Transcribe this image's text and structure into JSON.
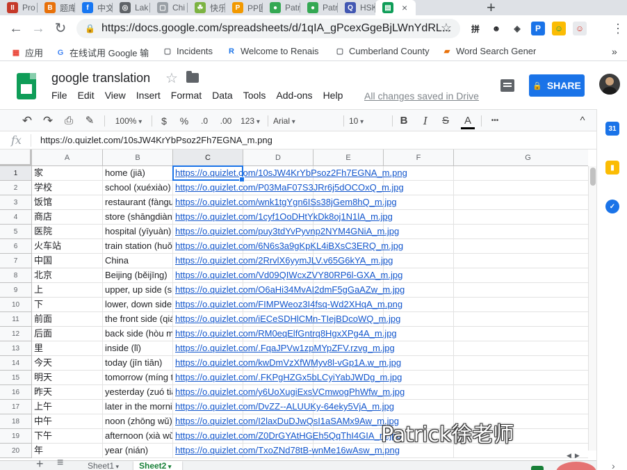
{
  "browser": {
    "tabs": [
      {
        "title": "Pro",
        "color": "#c53929",
        "glyph": "II"
      },
      {
        "title": "题库",
        "color": "#e8710a",
        "glyph": "B"
      },
      {
        "title": "中文",
        "color": "#1877f2",
        "glyph": "f"
      },
      {
        "title": "Lak",
        "color": "#5f6368",
        "glyph": "◎"
      },
      {
        "title": "Chi",
        "color": "#9aa0a6",
        "glyph": "▢"
      },
      {
        "title": "快乐",
        "color": "#7cb342",
        "glyph": "☘"
      },
      {
        "title": "PP匠",
        "color": "#f29900",
        "glyph": "P"
      },
      {
        "title": "Patr",
        "color": "#34a853",
        "glyph": "●"
      },
      {
        "title": "Patr",
        "color": "#34a853",
        "glyph": "●"
      },
      {
        "title": "HSK",
        "color": "#4257b2",
        "glyph": "Q"
      },
      {
        "title": "",
        "color": "#0f9d58",
        "glyph": "▤",
        "active": true
      }
    ],
    "active_tab_close": "×",
    "new_tab": "+",
    "url": "https://docs.google.com/spreadsheets/d/1qIA_gPcexGgeBjLWnYdRL...",
    "extensions": [
      {
        "name": "pinyin-extension-icon",
        "glyph": "拼",
        "bg": "#ffffff",
        "fg": "#202124"
      },
      {
        "name": "ninja-extension-icon",
        "glyph": "☻",
        "bg": "#ffffff",
        "fg": "#202124"
      },
      {
        "name": "shield-extension-icon",
        "glyph": "◈",
        "bg": "#ffffff",
        "fg": "#3c4043"
      },
      {
        "name": "p-extension-icon",
        "glyph": "P",
        "bg": "#1a73e8",
        "fg": "#ffffff"
      },
      {
        "name": "smile-extension-icon",
        "glyph": "☺",
        "bg": "#fbbc04",
        "fg": "#0f9d58"
      },
      {
        "name": "profile-extension-icon",
        "glyph": "☺",
        "bg": "#e8eaed",
        "fg": "#d93025"
      }
    ],
    "bookmarks": [
      {
        "label": "应用",
        "icon": "▦",
        "color": "#ea4335"
      },
      {
        "label": "在线试用 Google 输",
        "icon": "G",
        "color": "#4285f4"
      },
      {
        "label": "Incidents",
        "icon": "▢",
        "color": "#5f6368"
      },
      {
        "label": "Welcome to Renais",
        "icon": "R",
        "color": "#1a73e8"
      },
      {
        "label": "Cumberland County",
        "icon": "▢",
        "color": "#5f6368"
      },
      {
        "label": "Word Search Gener",
        "icon": "▰",
        "color": "#e8710a"
      }
    ],
    "bookmarks_more": "»"
  },
  "doc": {
    "title": "google translation",
    "menu": [
      "File",
      "Edit",
      "View",
      "Insert",
      "Format",
      "Data",
      "Tools",
      "Add-ons",
      "Help"
    ],
    "saved_status": "All changes saved in Drive",
    "share_label": "SHARE"
  },
  "toolbar": {
    "zoom": "100%",
    "currency": "$",
    "percent": "%",
    "decrease_decimal": ".0",
    "increase_decimal": ".00",
    "more_formats": "123",
    "font": "Arial",
    "font_size": "10",
    "bold": "B",
    "italic": "I",
    "strike": "S",
    "text_color": "A",
    "more": "•••",
    "collapse": "^"
  },
  "formula": {
    "fx": "fx",
    "value": "https://o.quizlet.com/10sJW4KrYbPsoz2Fh7EGNA_m.png"
  },
  "grid": {
    "columns": [
      "A",
      "B",
      "C",
      "D",
      "E",
      "F",
      "G"
    ],
    "rows": [
      {
        "n": "1",
        "a": "家",
        "b": "home   (jiā)",
        "c": "https://o.quizlet.com/10sJW4KrYbPsoz2Fh7EGNA_m.png"
      },
      {
        "n": "2",
        "a": "学校",
        "b": "school (xuéxiào)",
        "c": "https://o.quizlet.com/P03MaF07S3JRr6j5dOCOxQ_m.jpg"
      },
      {
        "n": "3",
        "a": "饭馆",
        "b": "restaurant (fànguǎn)",
        "c": "https://o.quizlet.com/wnk1tgYgn6ISs38jGem8hQ_m.jpg"
      },
      {
        "n": "4",
        "a": "商店",
        "b": "store (shāngdiàn)",
        "c": "https://o.quizlet.com/1cyf1OoDHtYkDk8oj1N1lA_m.jpg"
      },
      {
        "n": "5",
        "a": "医院",
        "b": "hospital (yīyuàn)",
        "c": "https://o.quizlet.com/puy3tdYvPyvnp2NYM4GNiA_m.jpg"
      },
      {
        "n": "6",
        "a": "火车站",
        "b": "train station (huǒchēzhàn)",
        "c": "https://o.quizlet.com/6N6s3a9gKpKL4iBXsC3ERQ_m.jpg"
      },
      {
        "n": "7",
        "a": "中国",
        "b": "China",
        "c": "https://o.quizlet.com/2RrvlX6yymJLV.v65G6kYA_m.jpg"
      },
      {
        "n": "8",
        "a": "北京",
        "b": "Beijing (běijīng)",
        "c": "https://o.quizlet.com/Vd09QIWcxZVY80RP6l-GXA_m.jpg"
      },
      {
        "n": "9",
        "a": "上",
        "b": "upper, up side (shàngbian)",
        "c": "https://o.quizlet.com/O6aHi34MvAI2dmF5gGaAZw_m.jpg"
      },
      {
        "n": "10",
        "a": "下",
        "b": "lower, down side (xiàbian)",
        "c": "https://o.quizlet.com/FIMPWeoz3I4fsq-Wd2XHqA_m.png"
      },
      {
        "n": "11",
        "a": "前面",
        "b": "the front side (qiánmiàn)",
        "c": "https://o.quizlet.com/iECeSDHlCMn-TIejBDcoWQ_m.jpg"
      },
      {
        "n": "12",
        "a": "后面",
        "b": "back side (hòu miàn)",
        "c": "https://o.quizlet.com/RM0eqElfGntrq8HgxXPg4A_m.jpg"
      },
      {
        "n": "13",
        "a": "里",
        "b": "inside (lǐ)",
        "c": "https://o.quizlet.com/.FqaJPVw1zpMYpZFV.rzvg_m.jpg"
      },
      {
        "n": "14",
        "a": "今天",
        "b": "today (jīn tiān)",
        "c": "https://o.quizlet.com/kwDmVzXfWMyv8l-vGp1A.w_m.jpg"
      },
      {
        "n": "15",
        "a": "明天",
        "b": "tomorrow (míng tiān)",
        "c": "https://o.quizlet.com/.FKPgHZGx5bLCyiYabJWDg_m.jpg"
      },
      {
        "n": "16",
        "a": "昨天",
        "b": "yesterday (zuó tiān)",
        "c": "https://o.quizlet.com/y6UoXugiExsVCmwogPhWfw_m.jpg"
      },
      {
        "n": "17",
        "a": "上午",
        "b": "later in the morning (shàngwǔ)",
        "c": "https://o.quizlet.com/DvZZ--ALUUKy-64eky5VjA_m.jpg"
      },
      {
        "n": "18",
        "a": "中午",
        "b": "noon (zhōng wǔ)",
        "c": "https://o.quizlet.com/I2laxDuDJwQsI1aSAMx9Aw_m.jpg"
      },
      {
        "n": "19",
        "a": "下午",
        "b": "afternoon (xià wǔ)",
        "c": "https://o.quizlet.com/Z0DrGYAtHGEh5QqThI4GIA_m.jpg"
      },
      {
        "n": "20",
        "a": "年",
        "b": "year (nián)",
        "c": "https://o.quizlet.com/TxoZNd78tB-wnMe16wAsw_m.png"
      }
    ]
  },
  "sheets": {
    "add": "+",
    "list": "≡",
    "tabs": [
      "Sheet1",
      "Sheet2"
    ],
    "active": "Sheet2"
  },
  "side": {
    "calendar": "31",
    "keep": "▮",
    "tasks": "✓",
    "expand": "›"
  },
  "watermark": "Patrick徐老师"
}
